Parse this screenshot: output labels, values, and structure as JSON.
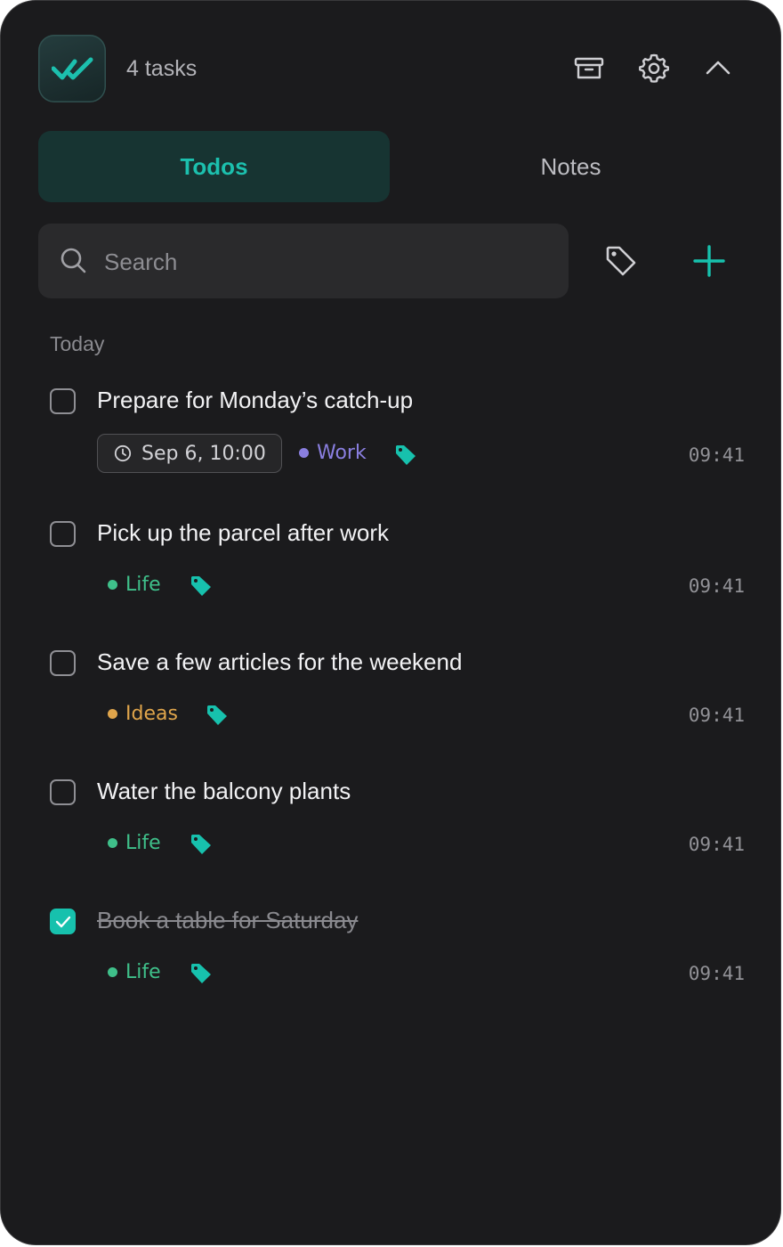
{
  "header": {
    "task_count": "4 tasks"
  },
  "tabs": [
    {
      "label": "Todos",
      "active": true
    },
    {
      "label": "Notes",
      "active": false
    }
  ],
  "search": {
    "placeholder": "Search"
  },
  "section_title": "Today",
  "colors": {
    "accent": "#17c1ad",
    "work": "#8a7fe0",
    "life": "#3fc08a",
    "ideas": "#e0a54b",
    "background": "#1b1b1d"
  },
  "todos": [
    {
      "title": "Prepare for Monday’s catch-up",
      "done": false,
      "due": "Sep 6, 10:00",
      "category": "Work",
      "time": "09:41"
    },
    {
      "title": "Pick up the parcel after work",
      "done": false,
      "category": "Life",
      "time": "09:41"
    },
    {
      "title": "Save a few articles for the weekend",
      "done": false,
      "category": "Ideas",
      "time": "09:41"
    },
    {
      "title": "Water the balcony plants",
      "done": false,
      "category": "Life",
      "time": "09:41"
    },
    {
      "title": "Book a table for Saturday",
      "done": true,
      "category": "Life",
      "time": "09:41"
    }
  ],
  "icons": [
    "double-check-logo-icon",
    "archive-icon",
    "gear-icon",
    "chevron-up-icon",
    "search-icon",
    "tag-icon",
    "plus-icon",
    "clock-icon",
    "tag-filled-icon",
    "checkmark-icon"
  ]
}
